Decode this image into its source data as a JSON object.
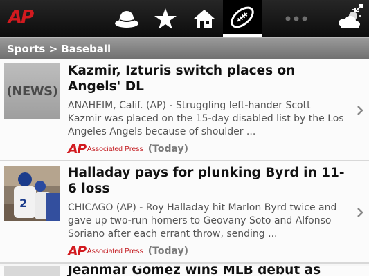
{
  "app": {
    "logo_text": "AP"
  },
  "nav": {
    "items": [
      {
        "name": "hat-icon"
      },
      {
        "name": "star-icon"
      },
      {
        "name": "home-icon"
      },
      {
        "name": "football-icon",
        "active": true
      },
      {
        "name": "more-icon"
      },
      {
        "name": "weather-icon"
      }
    ]
  },
  "breadcrumb": {
    "text": "Sports > Baseball"
  },
  "articles": [
    {
      "title": "Kazmir, Izturis switch places on Angels' DL",
      "summary": "ANAHEIM, Calif. (AP) - Struggling left-hander Scott Kazmir was placed on the 15-day disabled list by the Los Angeles Angels because of shoulder ...",
      "thumb_text": "(NEWS)",
      "source_logo": "AP",
      "source_name": "Associated Press",
      "time": "(Today)"
    },
    {
      "title": "Halladay pays for plunking Byrd in 11-6 loss",
      "summary": "CHICAGO (AP) - Roy Halladay hit Marlon Byrd twice and gave up two-run homers to Geovany Soto and Alfonso Soriano after each errant throw, sending ...",
      "source_logo": "AP",
      "source_name": "Associated Press",
      "time": "(Today)"
    },
    {
      "title": "Jeanmar Gomez wins MLB debut as"
    }
  ],
  "colors": {
    "brand_red": "#d21a1f",
    "topbar": "#111111",
    "crumb": "#888888"
  }
}
